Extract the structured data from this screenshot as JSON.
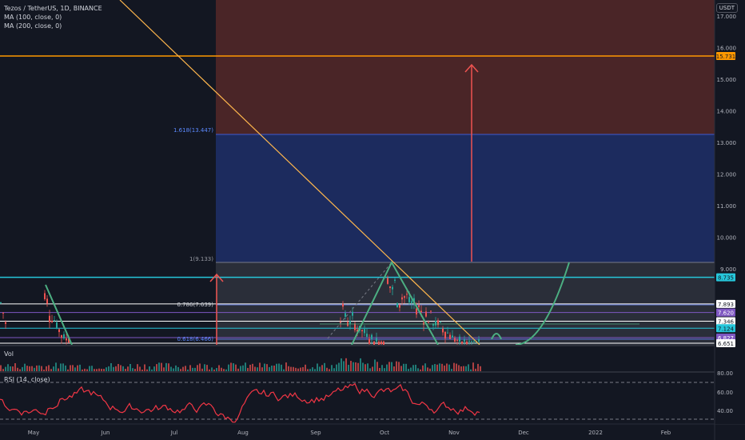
{
  "header": {
    "symbol_line": "Tezos / TetherUS, 1D, BINANCE",
    "indicators": [
      "MA (100, close, 0)",
      "MA (200, close, 0)"
    ],
    "currency": "USDT"
  },
  "volume_pane": {
    "title": "Vol"
  },
  "rsi_pane": {
    "title": "RSI (14, close)",
    "ticks": [
      "80.00",
      "60.00",
      "40.00"
    ]
  },
  "price_axis": {
    "ticks": [
      "17.000",
      "16.000",
      "15.000",
      "14.000",
      "13.000",
      "12.000",
      "11.000",
      "10.000",
      "9.000"
    ],
    "badges": [
      {
        "label": "15.731",
        "color": "#ff9800"
      },
      {
        "label": "8.735",
        "color": "#26c6da"
      },
      {
        "label": "7.893",
        "color": "#ffffff"
      },
      {
        "label": "7.620",
        "color": "#7e57c2"
      },
      {
        "label": "7.346",
        "color": "#ffffff"
      },
      {
        "label": "7.124",
        "color": "#26c6da"
      },
      {
        "label": "6.827",
        "color": "#7e57c2"
      },
      {
        "label": "6.651",
        "color": "#ffffff"
      }
    ]
  },
  "time_axis": {
    "labels": [
      "May",
      "Jun",
      "Jul",
      "Aug",
      "Sep",
      "Oct",
      "Nov",
      "Dec",
      "2022",
      "Feb"
    ]
  },
  "fib_labels": [
    "1.618(13.447)",
    "1(9.133)",
    "0.786(7.639)",
    "0.618(6.466)"
  ],
  "colors": {
    "background": "#131722",
    "up": "#26a69a",
    "down": "#ef5350",
    "target_zone": "#4a2527",
    "fib_zone": "#1c2b5e",
    "trendline": "#ffb74d",
    "arrow": "#ef5350",
    "curve": "#4caf82",
    "rsi": "#f23645"
  },
  "chart_data": {
    "type": "candlestick",
    "title": "Tezos / TetherUS, 1D, BINANCE",
    "y_range": [
      6.6,
      17.5
    ],
    "horizontal_levels": [
      {
        "value": 15.731,
        "color": "#ff9800"
      },
      {
        "value": 8.735,
        "color": "#26c6da"
      },
      {
        "value": 7.893,
        "color": "#ffffff"
      },
      {
        "value": 7.62,
        "color": "#7e57c2"
      },
      {
        "value": 7.346,
        "color": "#ffffff"
      },
      {
        "value": 7.124,
        "color": "#26c6da"
      },
      {
        "value": 6.827,
        "color": "#7e57c2"
      },
      {
        "value": 6.651,
        "color": "#ffffff"
      }
    ],
    "fib_levels": [
      {
        "label": "1.618(13.447)",
        "value": 13.447
      },
      {
        "label": "1(9.133)",
        "value": 9.133
      },
      {
        "label": "0.786(7.639)",
        "value": 7.639
      },
      {
        "label": "0.618(6.466)",
        "value": 6.466
      }
    ],
    "rsi": {
      "ylim": [
        30,
        85
      ],
      "levels": [
        70,
        30
      ]
    }
  }
}
